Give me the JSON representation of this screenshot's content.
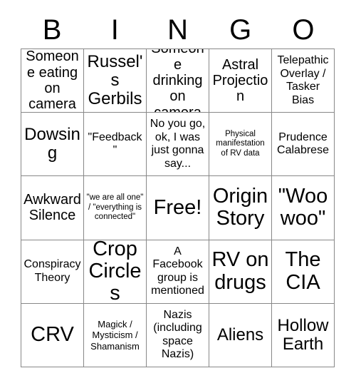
{
  "header": {
    "letters": [
      "B",
      "I",
      "N",
      "G",
      "O"
    ]
  },
  "grid": {
    "rows": 5,
    "columns": 5,
    "cells": [
      {
        "text": "Someone eating on camera",
        "size": "sz-lg"
      },
      {
        "text": "Russel's Gerbils",
        "size": "sz-xl"
      },
      {
        "text": "Someone drinking on camera",
        "size": "sz-lg"
      },
      {
        "text": "Astral Projection",
        "size": "sz-lg"
      },
      {
        "text": "Telepathic Overlay / Tasker Bias",
        "size": "sz-md"
      },
      {
        "text": "Dowsing",
        "size": "sz-xl"
      },
      {
        "text": "\"Feedback\"",
        "size": "sz-md"
      },
      {
        "text": "No you go, ok, I was just gonna say...",
        "size": "sz-md"
      },
      {
        "text": "Physical manifestation of RV data",
        "size": "sz-xs"
      },
      {
        "text": "Prudence Calabrese",
        "size": "sz-md"
      },
      {
        "text": "Awkward Silence",
        "size": "sz-lg"
      },
      {
        "text": "\"we are all one\" / \"everything is connected\"",
        "size": "sz-xs"
      },
      {
        "text": "Free!",
        "size": "sz-xxl"
      },
      {
        "text": "Origin Story",
        "size": "sz-xxl"
      },
      {
        "text": "\"Woo woo\"",
        "size": "sz-xxl"
      },
      {
        "text": "Conspiracy Theory",
        "size": "sz-md"
      },
      {
        "text": "Crop Circles",
        "size": "sz-xxl"
      },
      {
        "text": "A Facebook group is mentioned",
        "size": "sz-md"
      },
      {
        "text": "RV on drugs",
        "size": "sz-xxl"
      },
      {
        "text": "The CIA",
        "size": "sz-xxl"
      },
      {
        "text": "CRV",
        "size": "sz-xxl"
      },
      {
        "text": "Magick / Mysticism / Shamanism",
        "size": "sz-sm"
      },
      {
        "text": "Nazis (including space Nazis)",
        "size": "sz-md"
      },
      {
        "text": "Aliens",
        "size": "sz-xl"
      },
      {
        "text": "Hollow Earth",
        "size": "sz-xl"
      }
    ]
  },
  "colors": {
    "background": "#ffffff",
    "text": "#000000",
    "grid_line": "#888888"
  }
}
